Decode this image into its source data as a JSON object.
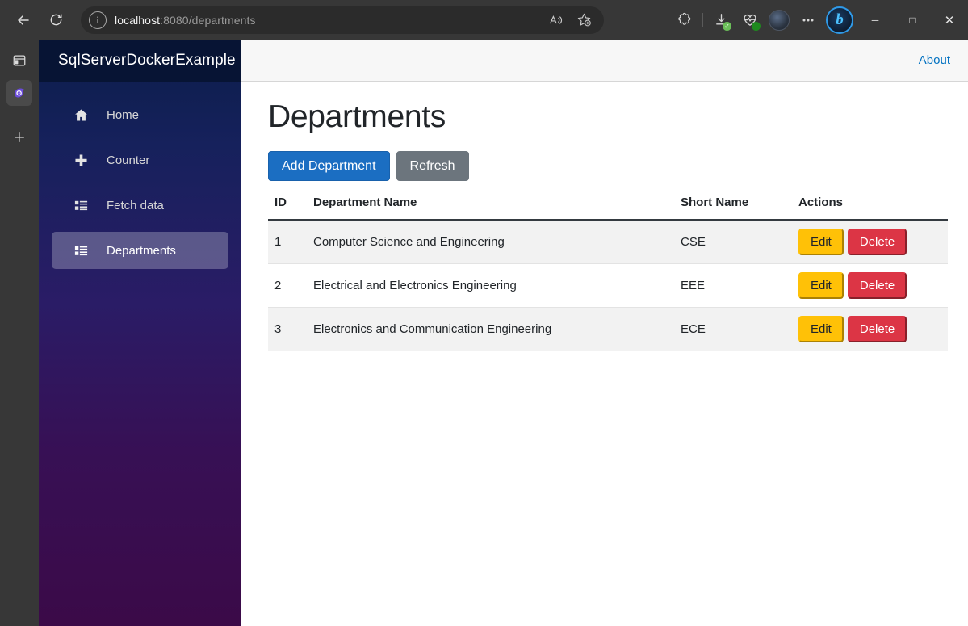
{
  "browser": {
    "back_label": "back-arrow",
    "reload_label": "reload",
    "info_glyph": "i",
    "url_host": "localhost",
    "url_rest": ":8080/departments",
    "address_icons": [
      {
        "name": "read-aloud-icon",
        "glyph": "A"
      },
      {
        "name": "add-favorite-icon",
        "glyph": "☆"
      }
    ],
    "toolbar_icons": [
      {
        "name": "extensions-icon",
        "glyph": "✦"
      },
      {
        "name": "downloads-icon",
        "glyph": "↓",
        "badge": "✓",
        "badge_color": "#6bbf59"
      },
      {
        "name": "browser-essentials-icon",
        "glyph": "♡",
        "badge": "",
        "badge_color": "#1f8a1f"
      },
      {
        "name": "profile-avatar",
        "glyph": ""
      },
      {
        "name": "settings-and-more-icon",
        "glyph": "⋯"
      },
      {
        "name": "copilot-icon",
        "glyph": "b"
      }
    ],
    "window_controls": [
      {
        "name": "minimize-button",
        "glyph": "─"
      },
      {
        "name": "maximize-button",
        "glyph": "□"
      },
      {
        "name": "close-button",
        "glyph": "✕"
      }
    ],
    "rail_items": [
      {
        "name": "tab-actions-icon",
        "glyph": "▣",
        "active": false
      },
      {
        "name": "copilot-app-icon",
        "glyph": "◕",
        "active": true
      },
      {
        "name": "add-sidebar-app-button",
        "glyph": "＋",
        "active": false
      }
    ]
  },
  "sidebar": {
    "brand": "SqlServerDockerExample",
    "items": [
      {
        "label": "Home",
        "icon": "home-icon",
        "active": false
      },
      {
        "label": "Counter",
        "icon": "plus-icon",
        "active": false
      },
      {
        "label": "Fetch data",
        "icon": "list-icon",
        "active": false
      },
      {
        "label": "Departments",
        "icon": "list-icon",
        "active": true
      }
    ]
  },
  "topbar": {
    "about_label": "About"
  },
  "main": {
    "title": "Departments",
    "add_button": "Add Department",
    "refresh_button": "Refresh",
    "table": {
      "columns": [
        "ID",
        "Department Name",
        "Short Name",
        "Actions"
      ],
      "rows": [
        {
          "id": "1",
          "name": "Computer Science and Engineering",
          "short": "CSE",
          "edit": "Edit",
          "delete": "Delete",
          "striped": true
        },
        {
          "id": "2",
          "name": "Electrical and Electronics Engineering",
          "short": "EEE",
          "edit": "Edit",
          "delete": "Delete",
          "striped": false
        },
        {
          "id": "3",
          "name": "Electronics and Communication Engineering",
          "short": "ECE",
          "edit": "Edit",
          "delete": "Delete",
          "striped": true
        }
      ]
    }
  },
  "colors": {
    "primary": "#1b6ec2",
    "secondary": "#6c757d",
    "warning": "#ffc107",
    "danger": "#dc3545",
    "link": "#0071c1",
    "brand_bar": "#071434"
  }
}
